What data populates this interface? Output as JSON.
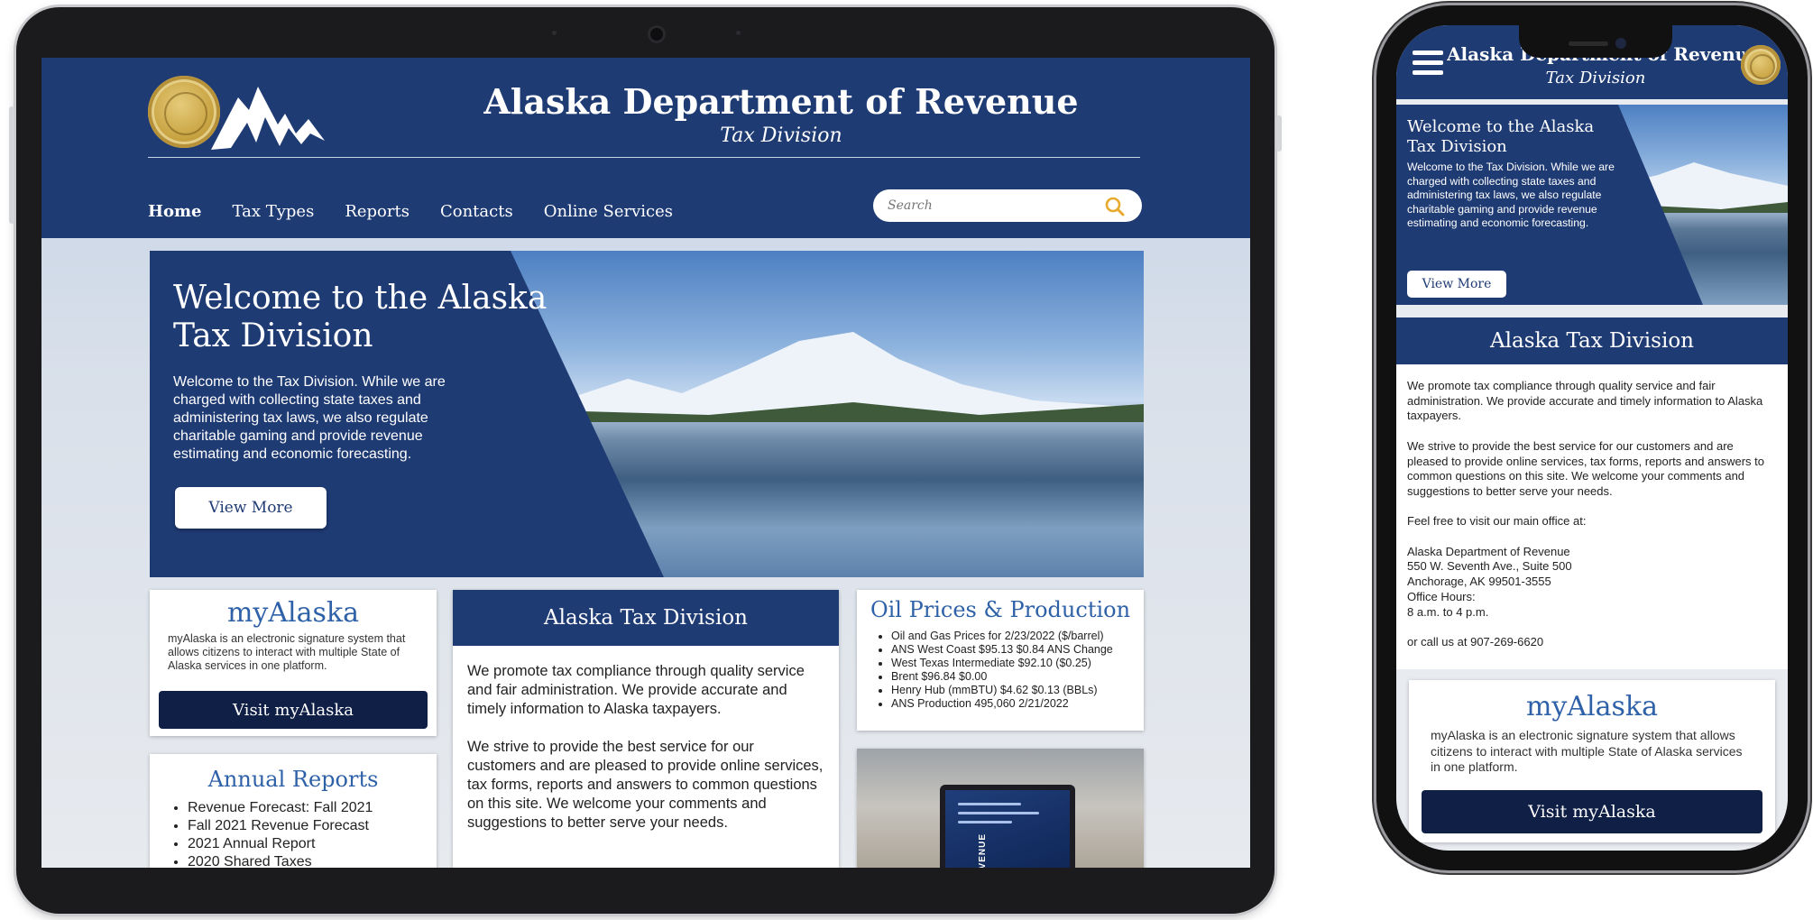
{
  "site": {
    "title": "Alaska Department of Revenue",
    "subtitle": "Tax Division"
  },
  "nav": [
    {
      "label": "Home",
      "active": true
    },
    {
      "label": "Tax Types"
    },
    {
      "label": "Reports"
    },
    {
      "label": "Contacts"
    },
    {
      "label": "Online Services"
    }
  ],
  "search": {
    "placeholder": "Search"
  },
  "hero": {
    "heading": "Welcome to the Alaska Tax Division",
    "text": "Welcome to the Tax Division. While we are charged with collecting state taxes and administering tax laws, we also regulate charitable gaming and provide revenue estimating and economic forecasting.",
    "button": "View More"
  },
  "myalaska": {
    "title": "myAlaska",
    "text": "myAlaska is an electronic signature system that allows citizens to interact with multiple State of Alaska services in one platform.",
    "button": "Visit myAlaska"
  },
  "annual_reports": {
    "title": "Annual Reports",
    "items": [
      "Revenue Forecast: Fall 2021",
      "Fall 2021 Revenue Forecast",
      "2021 Annual Report",
      "2020 Shared Taxes"
    ]
  },
  "tax_division": {
    "title": "Alaska Tax Division",
    "para1": "We promote tax compliance through quality service and fair administration. We provide accurate and timely information to Alaska taxpayers.",
    "para2": "We strive to provide the best service for our customers and are pleased to provide online services, tax forms, reports and answers to common questions on this site. We welcome your comments and suggestions to better serve your needs."
  },
  "oil": {
    "title": "Oil Prices & Production",
    "items": [
      "Oil and Gas Prices for 2/23/2022 ($/barrel)",
      "ANS West Coast $95.13 $0.84 ANS Change",
      "West Texas Intermediate $92.10 ($0.25)",
      "Brent $96.84 $0.00",
      "Henry Hub (mmBTU) $4.62 $0.13 (BBLs)",
      "ANS Production 495,060 2/21/2022"
    ]
  },
  "photo": {
    "laptop_text": "REVENUE"
  },
  "mobile": {
    "header_title": "Alaska Department of Revenue",
    "header_subtitle": "Tax Division",
    "hero_heading": "Welcome to the Alaska Tax Division",
    "hero_text": "Welcome to the Tax Division. While we are charged with collecting state taxes and administering tax laws, we also regulate charitable gaming and provide revenue estimating and economic forecasting.",
    "hero_button": "View More",
    "section_title": "Alaska Tax Division",
    "body": [
      "We promote tax compliance through quality service and fair administration. We provide accurate and timely information to Alaska taxpayers.",
      "We strive to provide the best service for our customers and are pleased to provide online services, tax forms, reports and answers to common questions on this site. We welcome your comments and suggestions to better serve your needs.",
      "Feel free to visit our main office at:"
    ],
    "address": [
      "Alaska Department of Revenue",
      "550 W. Seventh Ave., Suite 500",
      "Anchorage, AK 99501-3555",
      "Office Hours:",
      "8 a.m. to 4 p.m."
    ],
    "phone_line": "or call us at 907-269-6620",
    "myalaska_title": "myAlaska",
    "myalaska_text": "myAlaska is an electronic signature system that allows citizens to interact with multiple State of Alaska services in one platform.",
    "myalaska_button": "Visit myAlaska"
  },
  "colors": {
    "navy": "#1f3b74",
    "dark_navy": "#0f1f46",
    "link_blue": "#2e61a8",
    "gold": "#c9a544"
  }
}
